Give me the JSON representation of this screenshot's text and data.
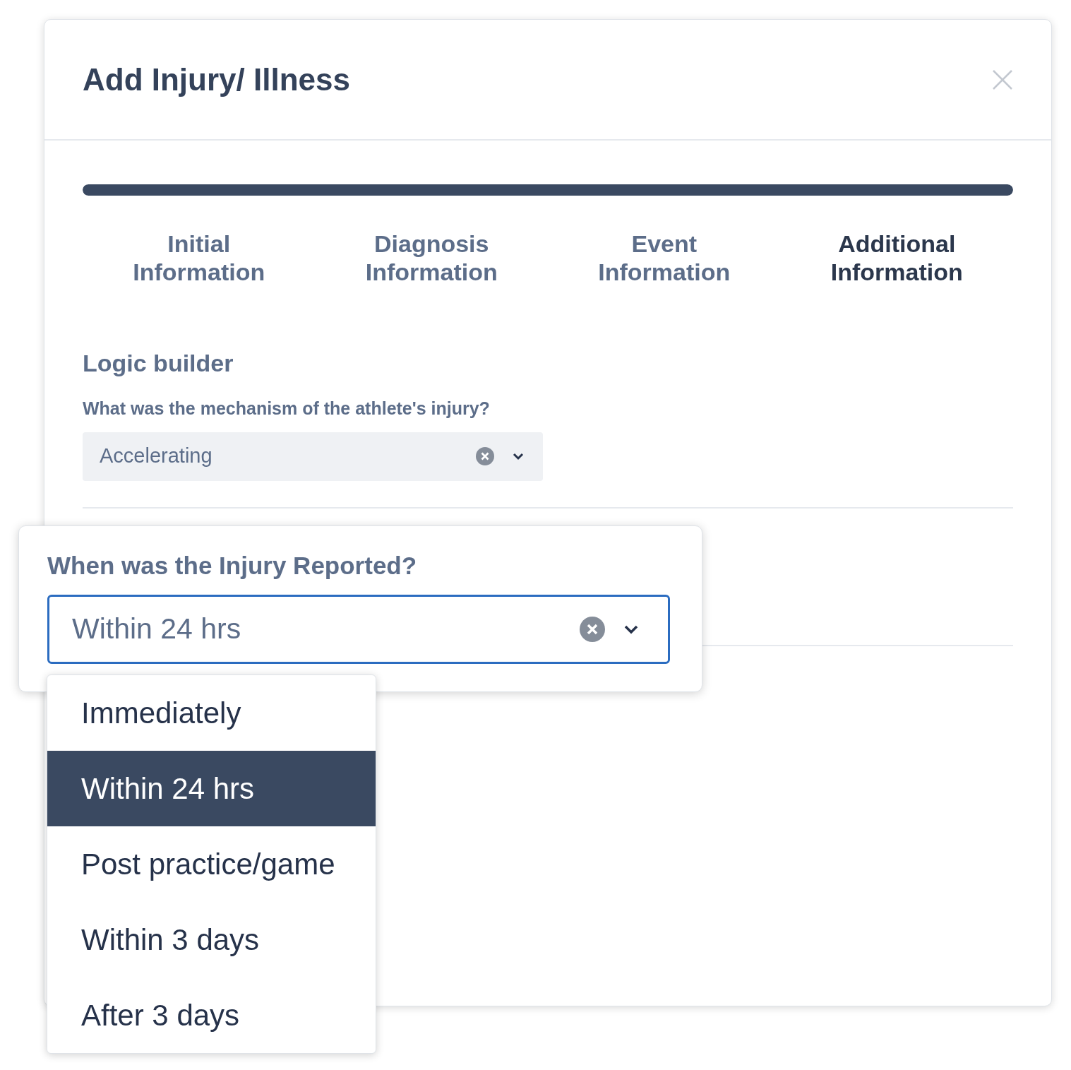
{
  "modal": {
    "title": "Add Injury/ Illness",
    "progress": {
      "level": 1
    },
    "steps": [
      {
        "label": "Initial Information",
        "selected": false
      },
      {
        "label": "Diagnosis Information",
        "selected": false
      },
      {
        "label": "Event Information",
        "selected": false
      },
      {
        "label": "Additional Information",
        "selected": true
      }
    ],
    "section": {
      "title": "Logic builder",
      "question": "What was the mechanism of the athlete's injury?",
      "select": {
        "value": "Accelerating"
      }
    }
  },
  "popup": {
    "label": "When was the Injury Reported?",
    "select": {
      "value": "Within 24 hrs",
      "focused": true
    },
    "options": [
      {
        "label": "Immediately",
        "selected": false
      },
      {
        "label": "Within 24 hrs",
        "selected": true
      },
      {
        "label": "Post practice/game",
        "selected": false
      },
      {
        "label": "Within 3 days",
        "selected": false
      },
      {
        "label": "After 3 days",
        "selected": false
      }
    ]
  }
}
